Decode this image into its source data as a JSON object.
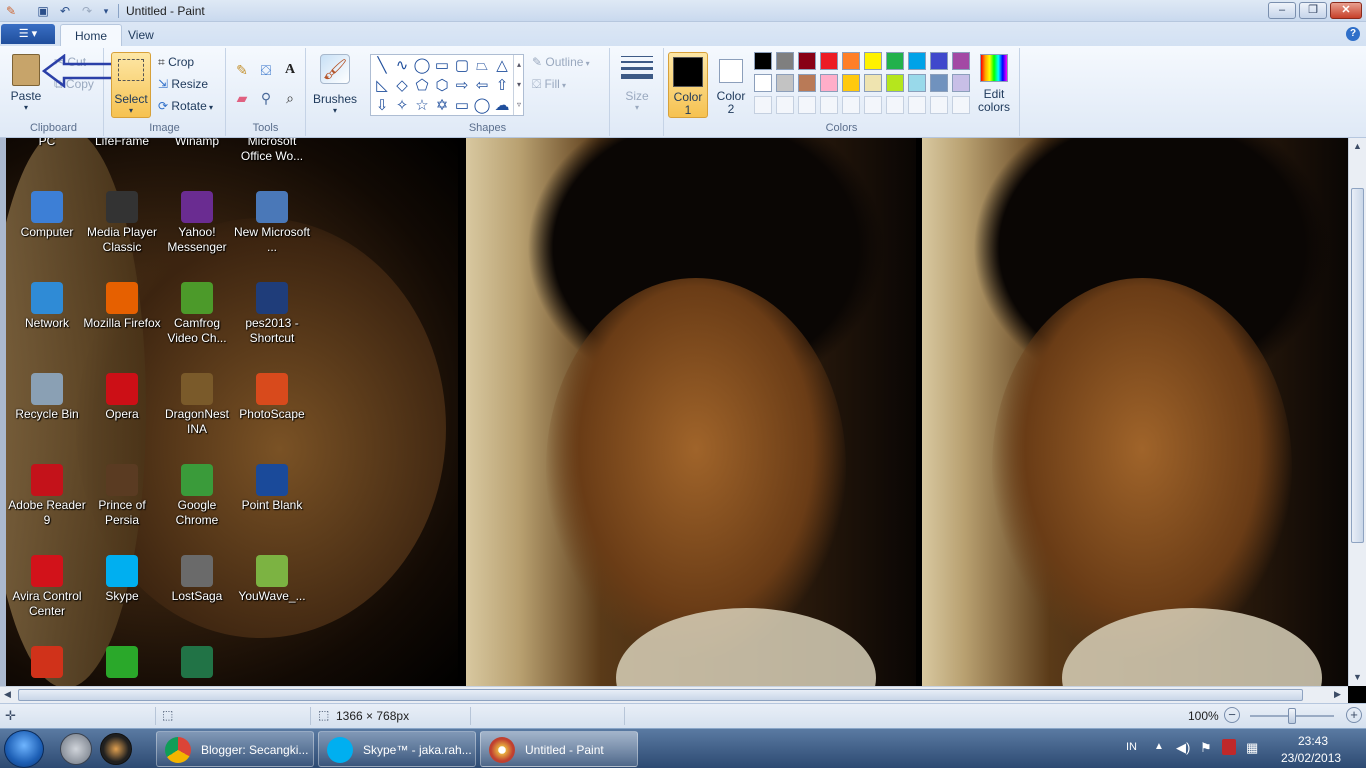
{
  "window": {
    "title": "Untitled - Paint",
    "buttons": {
      "minimize": "–",
      "maximize": "❐",
      "close": "✕"
    }
  },
  "quick_access": {
    "icons": [
      "save-icon",
      "undo-icon",
      "redo-icon",
      "customize-dropdown-icon"
    ]
  },
  "tabs": {
    "file": "☰ ▾",
    "home": "Home",
    "view": "View"
  },
  "ribbon": {
    "clipboard": {
      "label": "Clipboard",
      "paste": "Paste",
      "cut": "Cut",
      "copy": "Copy"
    },
    "image": {
      "label": "Image",
      "select": "Select",
      "crop": "Crop",
      "resize": "Resize",
      "rotate": "Rotate"
    },
    "tools": {
      "label": "Tools"
    },
    "brushes": {
      "label": "Brushes"
    },
    "shapes": {
      "label": "Shapes",
      "outline": "Outline",
      "fill": "Fill"
    },
    "size": {
      "label": "Size"
    },
    "colors": {
      "label": "Colors",
      "color1_line1": "Color",
      "color1_line2": "1",
      "color2_line1": "Color",
      "color2_line2": "2",
      "edit_line1": "Edit",
      "edit_line2": "colors",
      "color1": "#000000",
      "color2": "#ffffff",
      "row1": [
        "#000000",
        "#7f7f7f",
        "#880015",
        "#ed1c24",
        "#ff7f27",
        "#fff200",
        "#22b14c",
        "#00a2e8",
        "#3f48cc",
        "#a349a4"
      ],
      "row2": [
        "#ffffff",
        "#c3c3c3",
        "#b97a57",
        "#ffaec9",
        "#ffc90e",
        "#efe4b0",
        "#b5e61d",
        "#99d9ea",
        "#7092be",
        "#c8bfe7"
      ]
    }
  },
  "desktop_icons": [
    {
      "label": "PC",
      "icon": "computer-icon",
      "color": "#3d7fd6"
    },
    {
      "label": "LifeFrame",
      "icon": "lifeframe-icon",
      "color": "#555"
    },
    {
      "label": "Winamp",
      "icon": "winamp-icon",
      "color": "#e08a1e"
    },
    {
      "label": "Microsoft Office Wo...",
      "icon": "word-icon",
      "color": "#2b579a"
    },
    {
      "label": "Computer",
      "icon": "computer-icon",
      "color": "#3d7fd6"
    },
    {
      "label": "Media Player Classic",
      "icon": "media-player-icon",
      "color": "#333"
    },
    {
      "label": "Yahoo! Messenger",
      "icon": "yahoo-messenger-icon",
      "color": "#6a2c91"
    },
    {
      "label": "New Microsoft ...",
      "icon": "document-icon",
      "color": "#4a78b8"
    },
    {
      "label": "Network",
      "icon": "network-icon",
      "color": "#2f8bd6"
    },
    {
      "label": "Mozilla Firefox",
      "icon": "firefox-icon",
      "color": "#e66000"
    },
    {
      "label": "Camfrog Video Ch...",
      "icon": "camfrog-icon",
      "color": "#4c9a2a"
    },
    {
      "label": "pes2013 - Shortcut",
      "icon": "pes-icon",
      "color": "#1f3d7a"
    },
    {
      "label": "Recycle Bin",
      "icon": "recycle-bin-icon",
      "color": "#8aa0b4"
    },
    {
      "label": "Opera",
      "icon": "opera-icon",
      "color": "#cc0f16"
    },
    {
      "label": "DragonNest INA",
      "icon": "dragonnest-icon",
      "color": "#7a5a2a"
    },
    {
      "label": "PhotoScape",
      "icon": "photoscape-icon",
      "color": "#d84a1c"
    },
    {
      "label": "Adobe Reader 9",
      "icon": "adobe-reader-icon",
      "color": "#c4121a"
    },
    {
      "label": "Prince of Persia",
      "icon": "prince-of-persia-icon",
      "color": "#5a3b22"
    },
    {
      "label": "Google Chrome",
      "icon": "chrome-icon",
      "color": "#3a9b3a"
    },
    {
      "label": "Point Blank",
      "icon": "point-blank-icon",
      "color": "#1a4a9a"
    },
    {
      "label": "Avira Control Center",
      "icon": "avira-icon",
      "color": "#d2121a"
    },
    {
      "label": "Skype",
      "icon": "skype-icon",
      "color": "#00aff0"
    },
    {
      "label": "LostSaga",
      "icon": "lostsaga-icon",
      "color": "#6a6a6a"
    },
    {
      "label": "YouWave_...",
      "icon": "android-icon",
      "color": "#7cb342"
    },
    {
      "label": "",
      "icon": "ccleaner-icon",
      "color": "#d0321a"
    },
    {
      "label": "",
      "icon": "green-triangle-icon",
      "color": "#2aa82a"
    },
    {
      "label": "",
      "icon": "excel-icon",
      "color": "#217346"
    }
  ],
  "status": {
    "image_size": "1366 × 768px",
    "zoom": "100%"
  },
  "taskbar": {
    "buttons": [
      {
        "label": "Blogger: Secangki...",
        "icon": "chrome-icon"
      },
      {
        "label": "Skype™ - jaka.rah...",
        "icon": "skype-icon"
      },
      {
        "label": "Untitled - Paint",
        "icon": "paint-icon"
      }
    ],
    "language": "IN",
    "time": "23:43",
    "date": "23/02/2013"
  }
}
